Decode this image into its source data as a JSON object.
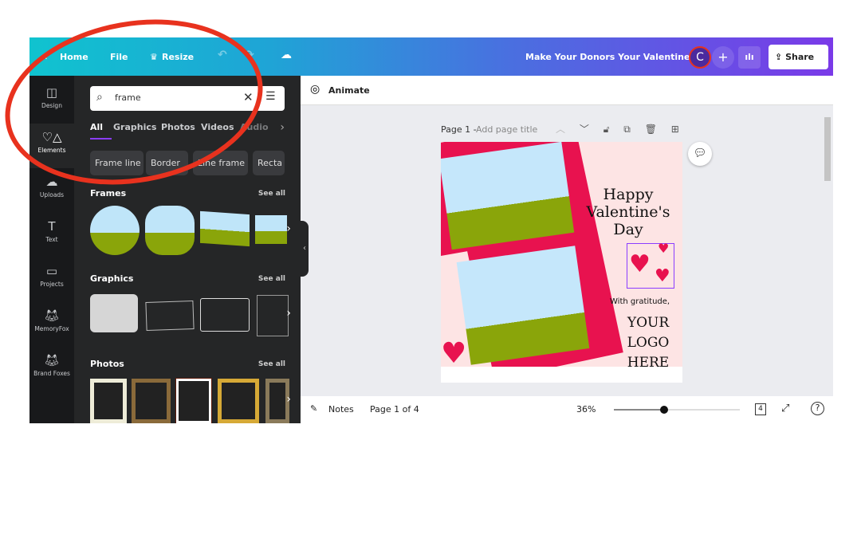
{
  "topbar": {
    "home": "Home",
    "file": "File",
    "resize": "Resize",
    "title": "Make Your Donors Your Valentines",
    "avatar": "C",
    "share": "Share"
  },
  "rail": [
    {
      "label": "Design",
      "icon": "layout-icon"
    },
    {
      "label": "Elements",
      "icon": "shapes-icon"
    },
    {
      "label": "Uploads",
      "icon": "upload-icon"
    },
    {
      "label": "Text",
      "icon": "text-icon"
    },
    {
      "label": "Projects",
      "icon": "folder-icon"
    },
    {
      "label": "MemoryFox",
      "icon": "memoryfox-app-icon"
    },
    {
      "label": "Brand Foxes",
      "icon": "brandfoxes-app-icon"
    }
  ],
  "panel": {
    "search_value": "frame",
    "tabs": [
      "All",
      "Graphics",
      "Photos",
      "Videos",
      "Audio"
    ],
    "chips": [
      "Frame line",
      "Border",
      "Line frame",
      "Recta"
    ],
    "sections": {
      "frames": "Frames",
      "graphics": "Graphics",
      "photos": "Photos",
      "see_all": "See all"
    }
  },
  "toolbar": {
    "animate": "Animate"
  },
  "page": {
    "label": "Page 1 -",
    "title_placeholder": "Add page title"
  },
  "design": {
    "heading1": "Happy",
    "heading2": "Valentine's",
    "heading3": "Day",
    "gratitude": "With gratitude,",
    "logo1": "YOUR",
    "logo2": "LOGO",
    "logo3": "HERE"
  },
  "bottom": {
    "notes": "Notes",
    "page_count": "Page 1 of 4",
    "zoom": "36%",
    "zoom_value": 36,
    "pages_badge": "4"
  },
  "colors": {
    "accent": "#8b3dff",
    "annotation": "#e8321e",
    "frame_red": "#e8124f"
  }
}
